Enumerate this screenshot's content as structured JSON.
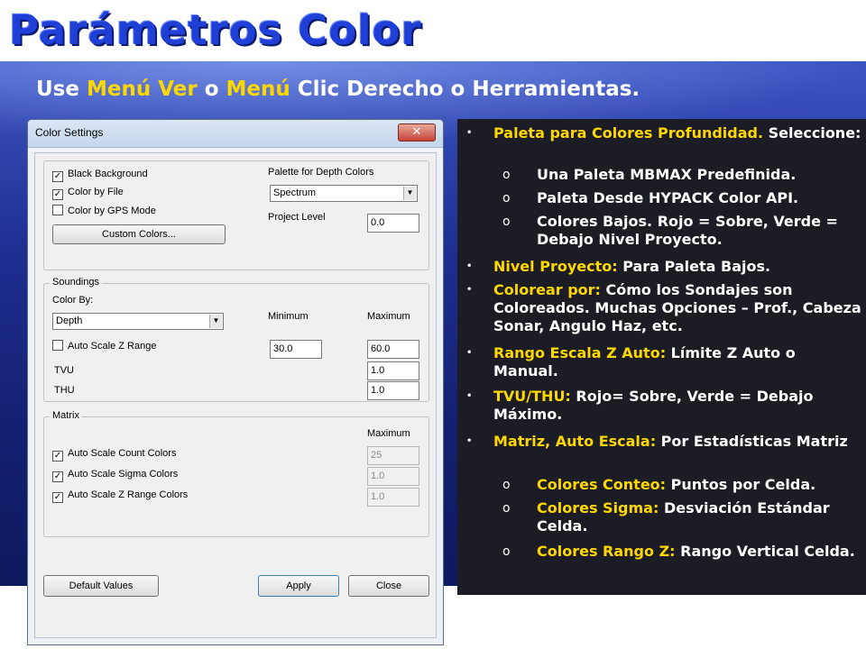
{
  "title": "Parámetros Color",
  "subtitle": {
    "p1": "Use ",
    "h1": "Menú Ver",
    "p2": " o ",
    "h2": "Menú",
    "p3": " Clic Derecho o Herramientas."
  },
  "dialog": {
    "title": "Color Settings",
    "close": "✕",
    "display": {
      "black_background": {
        "label": "Black Background",
        "checked": "✓"
      },
      "color_by_file": {
        "label": "Color by File",
        "checked": "✓"
      },
      "color_by_gps_mode": {
        "label": "Color by GPS Mode",
        "checked": ""
      },
      "custom_colors_button": "Custom Colors...",
      "palette_label": "Palette for Depth Colors",
      "palette_value": "Spectrum",
      "project_level_label": "Project Level",
      "project_level_value": "0.0"
    },
    "soundings": {
      "group_label": "Soundings",
      "color_by_label": "Color By:",
      "color_by_value": "Depth",
      "auto_scale": {
        "label": "Auto Scale Z Range",
        "checked": ""
      },
      "minimum_label": "Minimum",
      "maximum_label": "Maximum",
      "minimum_value": "30.0",
      "maximum_value": "60.0",
      "tvu_label": "TVU",
      "tvu_value": "1.0",
      "thu_label": "THU",
      "thu_value": "1.0"
    },
    "matrix": {
      "group_label": "Matrix",
      "maximum_label": "Maximum",
      "count": {
        "label": "Auto Scale Count Colors",
        "checked": "✓",
        "value": "25"
      },
      "sigma": {
        "label": "Auto Scale Sigma Colors",
        "checked": "✓",
        "value": "1.0"
      },
      "zrange": {
        "label": "Auto Scale Z Range Colors",
        "checked": "✓",
        "value": "1.0"
      }
    },
    "buttons": {
      "default_values": "Default Values",
      "apply": "Apply",
      "close": "Close"
    }
  },
  "panel": {
    "b1": {
      "hl": "Paleta para Colores Profundidad.",
      "rest": " Seleccione:"
    },
    "b1_subs": [
      "Una Paleta MBMAX Predefinida.",
      "Paleta Desde HYPACK Color API.",
      "Colores Bajos.  Rojo = Sobre, Verde = Debajo Nivel Proyecto."
    ],
    "b2": {
      "hl": "Nivel Proyecto:",
      "rest": " Para Paleta Bajos."
    },
    "b3": {
      "hl": "Colorear por:",
      "rest": " Cómo los Sondajes son Coloreados.  Muchas Opciones – Prof., Cabeza Sonar, Angulo Haz, etc."
    },
    "b4": {
      "hl": "Rango Escala Z Auto:",
      "rest": " Límite Z Auto o Manual."
    },
    "b5": {
      "hl": "TVU/THU:",
      "rest": " Rojo= Sobre, Verde = Debajo Máximo."
    },
    "b6": {
      "hl": "Matriz, Auto Escala:",
      "rest": " Por Estadísticas Matriz"
    },
    "b6_subs": [
      {
        "hl": "Colores Conteo:",
        "rest": " Puntos por Celda."
      },
      {
        "hl": "Colores Sigma:",
        "rest": " Desviación Estándar Celda."
      },
      {
        "hl": "Colores Rango Z:",
        "rest": " Rango Vertical Celda."
      }
    ],
    "bullet": "•",
    "sub_marker": "o"
  },
  "colors": {
    "title": "#1f3fd6",
    "highlight": "#ffd700",
    "panel_bg": "#1c1c24",
    "stage_bg": "#1f2f92"
  }
}
